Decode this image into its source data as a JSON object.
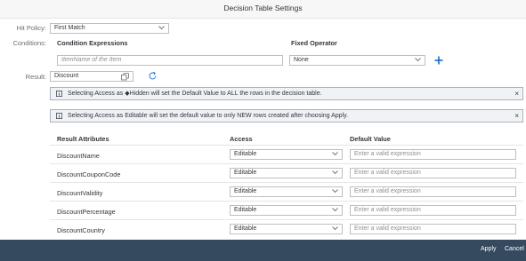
{
  "dialog": {
    "title": "Decision Table Settings"
  },
  "hit_policy": {
    "label": "Hit Policy:",
    "value": "First Match"
  },
  "conditions": {
    "label": "Conditions:",
    "header_expressions": "Condition Expressions",
    "header_operator": "Fixed Operator",
    "expression_placeholder": "ItemName of the Item",
    "operator_value": "None"
  },
  "result": {
    "label": "Result:",
    "value": "Discount"
  },
  "messages": [
    {
      "text": "Selecting Access as ◆Hidden will set the Default Value to ALL the rows in the decision table."
    },
    {
      "text": "Selecting Access as Editable will set the default value to only NEW rows created after choosing Apply."
    }
  ],
  "table": {
    "headers": {
      "attribute": "Result Attributes",
      "access": "Access",
      "default": "Default Value"
    },
    "rows": [
      {
        "attribute": "DiscountName",
        "access": "Editable",
        "default_placeholder": "Enter a valid expression"
      },
      {
        "attribute": "DiscountCouponCode",
        "access": "Editable",
        "default_placeholder": "Enter a valid expression"
      },
      {
        "attribute": "DiscountValidity",
        "access": "Editable",
        "default_placeholder": "Enter a valid expression"
      },
      {
        "attribute": "DiscountPercentage",
        "access": "Editable",
        "default_placeholder": "Enter a valid expression"
      },
      {
        "attribute": "DiscountCountry",
        "access": "Editable",
        "default_placeholder": "Enter a valid expression"
      }
    ]
  },
  "footer": {
    "apply_label": "Apply",
    "cancel_label": "Cancel"
  },
  "colors": {
    "footer_bg": "#354a5f",
    "accent": "#0a6ed1",
    "message_bg": "#f0f3f6"
  }
}
